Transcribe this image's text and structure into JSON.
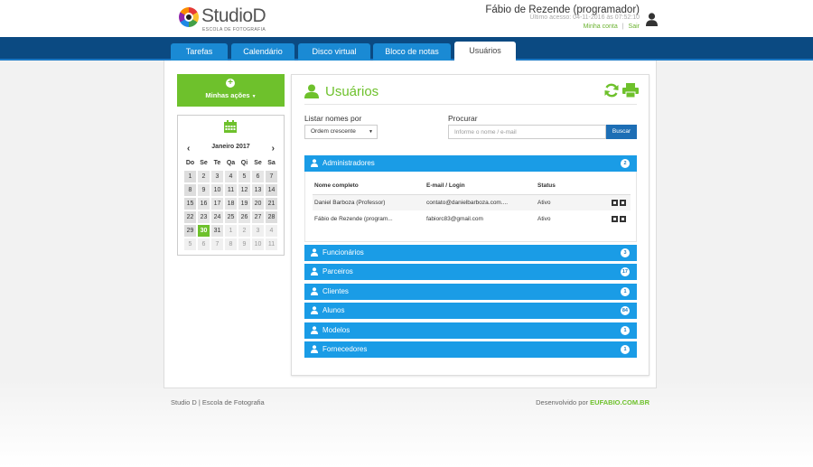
{
  "header": {
    "logo_name": "StudioD",
    "logo_sub": "ESCOLA DE FOTOGRAFIA",
    "user_name": "Fábio de Rezende (programador)",
    "last_access": "Último acesso: 04-11-2016 às 07:52:10",
    "link_account": "Minha conta",
    "link_separator": "|",
    "link_logout": "Sair"
  },
  "nav": {
    "tabs": [
      {
        "label": "Tarefas"
      },
      {
        "label": "Calendário"
      },
      {
        "label": "Disco virtual"
      },
      {
        "label": "Bloco de notas"
      },
      {
        "label": "Usuários"
      }
    ],
    "active_index": 4
  },
  "sidebar": {
    "actions_label": "Minhas ações",
    "actions_plus": "+",
    "calendar": {
      "prev": "‹",
      "next": "›",
      "month_label": "Janeiro 2017",
      "weekdays": [
        "Do",
        "Se",
        "Te",
        "Qa",
        "Qi",
        "Se",
        "Sa"
      ],
      "weeks": [
        [
          "1",
          "2",
          "3",
          "4",
          "5",
          "6",
          "7"
        ],
        [
          "8",
          "9",
          "10",
          "11",
          "12",
          "13",
          "14"
        ],
        [
          "15",
          "16",
          "17",
          "18",
          "19",
          "20",
          "21"
        ],
        [
          "22",
          "23",
          "24",
          "25",
          "26",
          "27",
          "28"
        ],
        [
          "29",
          "30",
          "31",
          "1",
          "2",
          "3",
          "4"
        ],
        [
          "5",
          "6",
          "7",
          "8",
          "9",
          "10",
          "11"
        ]
      ],
      "today": "30"
    }
  },
  "main": {
    "title": "Usuários",
    "list_label": "Listar nomes por",
    "order_value": "Ordem crescente",
    "order_caret": "▼",
    "search_label": "Procurar",
    "search_placeholder": "Informe o nome / e-mail",
    "search_button": "Buscar",
    "groups": [
      {
        "name": "Administradores",
        "count": "2"
      },
      {
        "name": "Funcionários",
        "count": "3"
      },
      {
        "name": "Parceiros",
        "count": "17"
      },
      {
        "name": "Clientes",
        "count": "1"
      },
      {
        "name": "Alunos",
        "count": "84"
      },
      {
        "name": "Modelos",
        "count": "1"
      },
      {
        "name": "Fornecedores",
        "count": "1"
      }
    ],
    "table": {
      "headers": {
        "name": "Nome completo",
        "email": "E-mail / Login",
        "status": "Status"
      },
      "rows": [
        {
          "name": "Daniel Barboza (Professor)",
          "email": "contato@danielbarboza.com....",
          "status": "Ativo"
        },
        {
          "name": "Fábio de Rezende (program...",
          "email": "fabiorc83@gmail.com",
          "status": "Ativo"
        }
      ]
    }
  },
  "footer": {
    "left": "Studio D | Escola de Fotografia",
    "right_prefix": "Desenvolvido por",
    "right_brand": "EUFABIO.COM.BR"
  },
  "colors": {
    "green": "#6ec12c",
    "nav_dark": "#0b4a82",
    "tab_blue": "#1a8ad4",
    "group_blue": "#1a9ce6",
    "button_blue": "#1d6eb5"
  }
}
